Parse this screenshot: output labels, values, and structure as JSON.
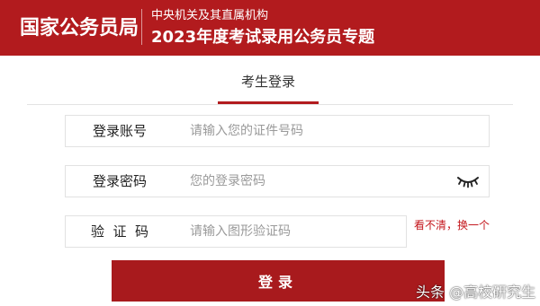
{
  "header": {
    "org_name": "国家公务员局",
    "subtitle_small": "中央机关及其直属机构",
    "subtitle_big": "2023年度考试录用公务员专题"
  },
  "tab": {
    "label": "考生登录"
  },
  "form": {
    "account": {
      "label": "登录账号",
      "placeholder": "请输入您的证件号码",
      "value": ""
    },
    "password": {
      "label": "登录密码",
      "placeholder": "您的登录密码",
      "value": ""
    },
    "captcha": {
      "label": "验  证  码",
      "placeholder": "请输入图形验证码",
      "value": "",
      "refresh_label": "看不清，换一个"
    },
    "submit_label": "登录"
  },
  "watermark": "头条 @高校研究生",
  "colors": {
    "brand_red": "#b21b1e",
    "button_red": "#a81a1d",
    "link_red": "#c4161c"
  },
  "icons": {
    "password_toggle": "eye-closed-icon"
  }
}
